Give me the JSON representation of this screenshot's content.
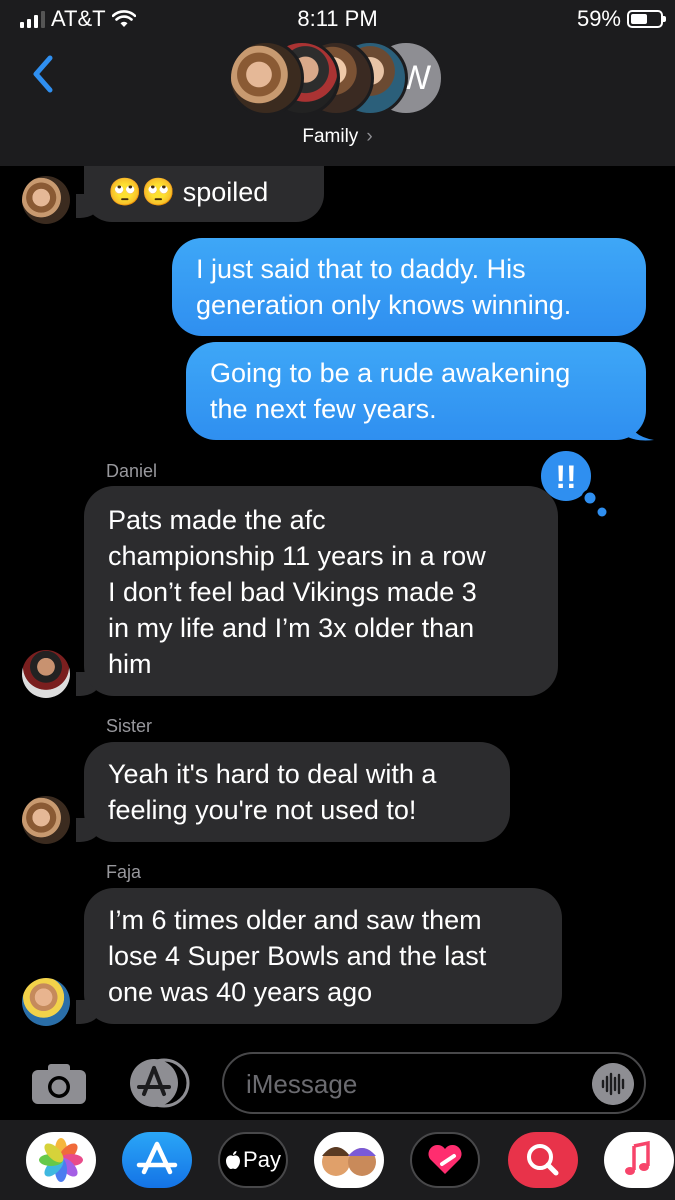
{
  "status": {
    "carrier": "AT&T",
    "time": "8:11 PM",
    "battery": "59%"
  },
  "header": {
    "group_name": "Family",
    "chevron": "›",
    "avatar_initial": "W"
  },
  "messages": [
    {
      "type": "in",
      "text_lines": [
        "🙄🙄 spoiled"
      ]
    },
    {
      "type": "out",
      "text_lines": [
        "I just said that to daddy. His",
        "generation only knows winning."
      ]
    },
    {
      "type": "out",
      "text_lines": [
        "Going to be a rude awakening",
        "the next few years."
      ]
    },
    {
      "type": "in",
      "sender": "Daniel",
      "text_lines": [
        "Pats made the afc",
        "championship 11 years in a row",
        "I don’t feel bad Vikings made 3",
        "in my life and I’m 3x older than",
        "him"
      ]
    },
    {
      "type": "in",
      "sender": "Sister",
      "text_lines": [
        "Yeah it's hard to deal with a",
        "feeling you're not used to!"
      ]
    },
    {
      "type": "in",
      "sender": "Faja",
      "text_lines": [
        "I’m 6 times older and saw them",
        "lose 4 Super Bowls and the last",
        "one was 40 years ago"
      ]
    }
  ],
  "tapback": {
    "icon": "exclamation-tapback-icon",
    "text": "!!"
  },
  "input": {
    "placeholder": "iMessage"
  },
  "app_drawer": {
    "apple_pay_label": "Pay"
  },
  "colors": {
    "accent": "#2f8ff0",
    "incoming_bubble": "#2c2c2e",
    "header_bg": "#1c1c1e"
  }
}
